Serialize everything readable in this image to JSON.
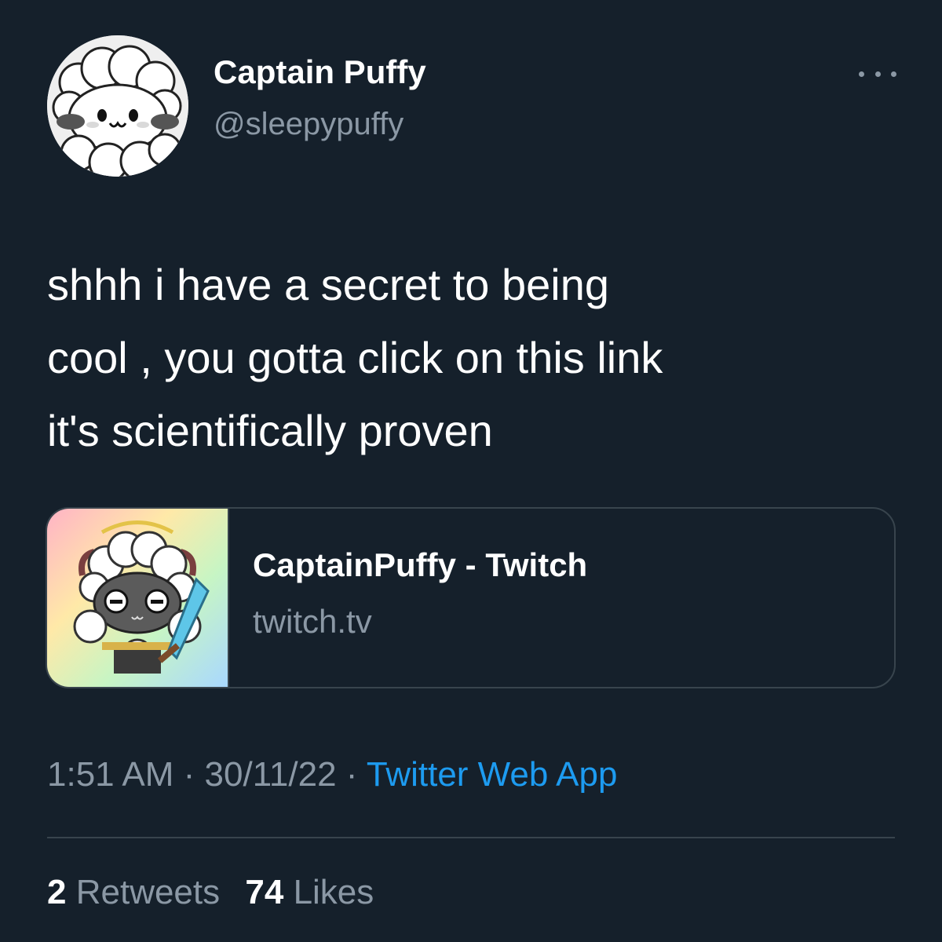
{
  "author": {
    "display_name": "Captain Puffy",
    "handle": "@sleepypuffy",
    "avatar_icon": "fluffy-sheep-avatar"
  },
  "more_icon": "more-horizontal-icon",
  "tweet": {
    "text": "shhh i have a secret to being\ncool , you gotta click on this link\nit's scientifically proven"
  },
  "link_card": {
    "title": "CaptainPuffy - Twitch",
    "domain": "twitch.tv",
    "thumbnail_icon": "sheep-warrior-thumbnail"
  },
  "meta": {
    "time": "1:51 AM",
    "sep1": " · ",
    "date": "30/11/22",
    "sep2": " · ",
    "source": "Twitter Web App"
  },
  "stats": {
    "retweets_count": "2",
    "retweets_label": "Retweets",
    "likes_count": "74",
    "likes_label": "Likes"
  },
  "colors": {
    "background": "#15202b",
    "text_primary": "#ffffff",
    "text_secondary": "#8b98a5",
    "link": "#1d9bf0",
    "border": "#38444d"
  }
}
